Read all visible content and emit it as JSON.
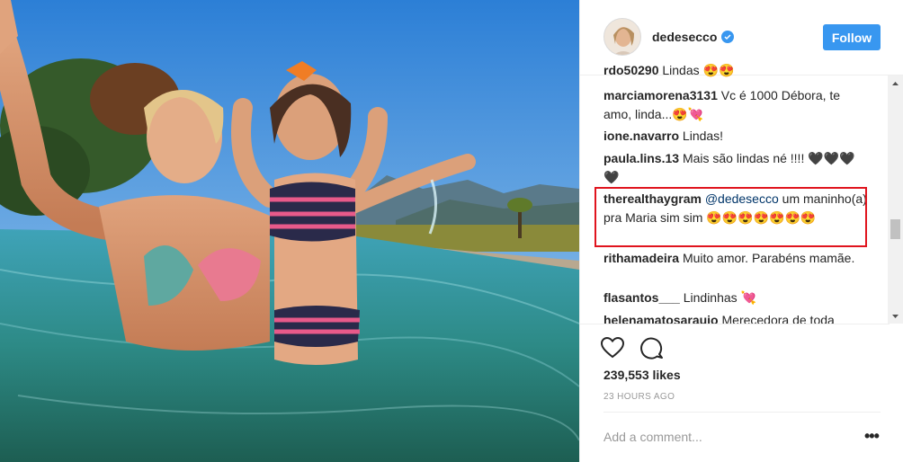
{
  "post": {
    "photo_alt": "",
    "username": "dedesecco",
    "follow_label": "Follow",
    "likes": "239,553 likes",
    "time": "23 HOURS AGO",
    "add_comment_placeholder": "Add a comment...",
    "more_glyph": "•••"
  },
  "comments": [
    {
      "user": "rdo50290",
      "text": "Lindas 😍😍"
    },
    {
      "user": "marciamorena3131",
      "text": "Vc é 1000 Débora, te amo, linda...😍💘"
    },
    {
      "user": "ione.navarro",
      "text": "Lindas!"
    },
    {
      "user": "paula.lins.13",
      "text": "Mais são lindas né !!!! 🖤🖤🖤🖤"
    },
    {
      "user": "therealthaygram",
      "mention": "@dedesecco",
      "text": "um maninho(a) pra Maria sim sim 😍😍😍😍😍😍😍"
    },
    {
      "user": "rithamadeira",
      "text": "Muito amor. Parabéns mamãe."
    },
    {
      "user": "flasantos___",
      "text": "Lindinhas 💘"
    },
    {
      "user": "helenamatosaraujo",
      "text": "Merecedora de toda"
    }
  ],
  "icons": {
    "verified": "verified-badge-icon",
    "heart": "heart-icon",
    "comment": "comment-icon",
    "more": "more-options-icon"
  },
  "colors": {
    "accent": "#3897f0",
    "highlight": "#e0141e",
    "muted": "#999999"
  }
}
